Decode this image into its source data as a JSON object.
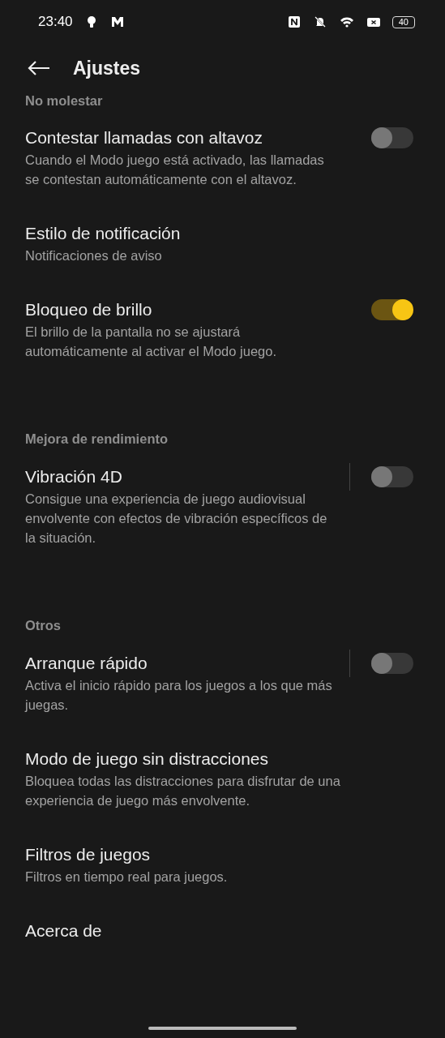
{
  "status_bar": {
    "time": "23:40",
    "battery": "40"
  },
  "app_bar": {
    "title": "Ajustes"
  },
  "sections": [
    {
      "header": "No molestar",
      "items": [
        {
          "kind": "toggle",
          "title": "Contestar llamadas con altavoz",
          "subtitle": "Cuando el Modo juego está activado, las llamadas se contestan automáticamente con el altavoz.",
          "on": false,
          "divider": false
        },
        {
          "kind": "plain",
          "title": "Estilo de notificación",
          "subtitle": "Notificaciones de aviso"
        },
        {
          "kind": "toggle",
          "title": "Bloqueo de brillo",
          "subtitle": "El brillo de la pantalla no se ajustará automáticamente al activar el Modo juego.",
          "on": true,
          "divider": false
        }
      ]
    },
    {
      "header": "Mejora de rendimiento",
      "items": [
        {
          "kind": "toggle",
          "title": "Vibración 4D",
          "subtitle": "Consigue una experiencia de juego audiovisual envolvente con efectos de vibración específicos de la situación.",
          "on": false,
          "divider": true
        }
      ]
    },
    {
      "header": "Otros",
      "items": [
        {
          "kind": "toggle",
          "title": "Arranque rápido",
          "subtitle": "Activa el inicio rápido para los juegos a los que más juegas.",
          "on": false,
          "divider": true
        },
        {
          "kind": "plain",
          "title": "Modo de juego sin distracciones",
          "subtitle": "Bloquea todas las distracciones para disfrutar de una experiencia de juego más envolvente."
        },
        {
          "kind": "plain",
          "title": "Filtros de juegos",
          "subtitle": "Filtros en tiempo real para juegos."
        },
        {
          "kind": "plain",
          "title": "Acerca de"
        }
      ]
    }
  ]
}
